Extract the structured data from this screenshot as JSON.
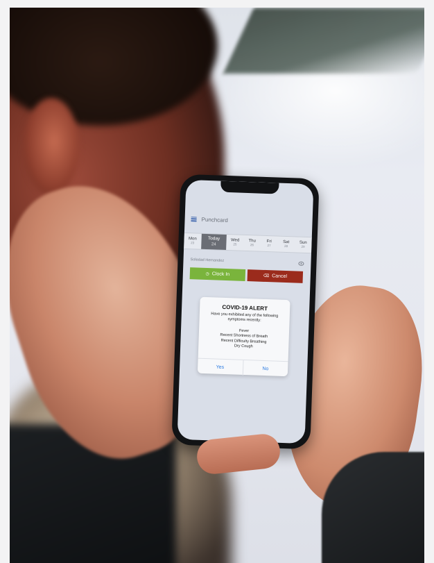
{
  "app": {
    "title": "Punchcard",
    "menu_icon": "hamburger-menu-icon"
  },
  "calendar": {
    "days": [
      {
        "name": "Mon",
        "num": "23"
      },
      {
        "name": "Today",
        "num": "24",
        "selected": true
      },
      {
        "name": "Wed",
        "num": "25"
      },
      {
        "name": "Thu",
        "num": "26"
      },
      {
        "name": "Fri",
        "num": "27"
      },
      {
        "name": "Sat",
        "num": "28"
      },
      {
        "name": "Sun",
        "num": "29"
      }
    ]
  },
  "employee": {
    "name": "Soledad Hernandez",
    "icon": "eye-icon"
  },
  "actions": {
    "clock_in": "Clock In",
    "cancel": "Cancel",
    "clock_in_icon": "clock-icon",
    "cancel_icon": "backspace-icon",
    "colors": {
      "clock_in": "#7ab43c",
      "cancel": "#9b2b1c"
    }
  },
  "alert": {
    "title": "COVID-19 ALERT",
    "message": "Have you exhibited any of the following symptoms recently:",
    "symptoms": [
      "Fever",
      "Recent Shortness of Breath",
      "Recent Difficulty Breathing",
      "Dry Cough"
    ],
    "yes": "Yes",
    "no": "No",
    "link_color": "#2f7de1"
  }
}
